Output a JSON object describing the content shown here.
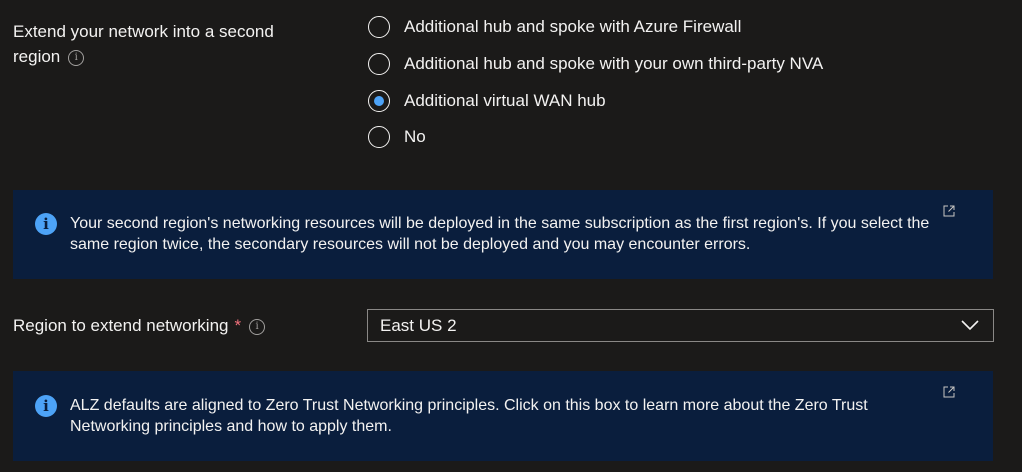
{
  "extend_region": {
    "label_line1": "Extend your network into a second",
    "label_line2": "region",
    "info_icon": "info-icon",
    "options": [
      {
        "label": "Additional hub and spoke with Azure Firewall",
        "selected": false
      },
      {
        "label": "Additional hub and spoke with your own third-party NVA",
        "selected": false
      },
      {
        "label": "Additional virtual WAN hub",
        "selected": true
      },
      {
        "label": "No",
        "selected": false
      }
    ]
  },
  "info_box_1": {
    "icon": "info-icon",
    "text": "Your second region's networking resources will be deployed in the same subscription as the first region's.  If you select the same region twice, the secondary resources will not be deployed and you may encounter errors.",
    "link_icon": "external-link-icon"
  },
  "region_field": {
    "label": "Region to extend networking",
    "required_mark": "*",
    "info_icon": "info-icon",
    "value": "East US 2",
    "chevron_icon": "chevron-down-icon"
  },
  "info_box_2": {
    "icon": "info-icon",
    "text": "ALZ defaults are aligned to Zero Trust Networking principles. Click on this box to learn more about the Zero Trust Networking principles and how to apply them.",
    "link_icon": "external-link-icon"
  },
  "colors": {
    "background": "#1b1a19",
    "info_box_bg": "#0a1e3d",
    "accent": "#4da3f7",
    "required": "#f1707b"
  }
}
